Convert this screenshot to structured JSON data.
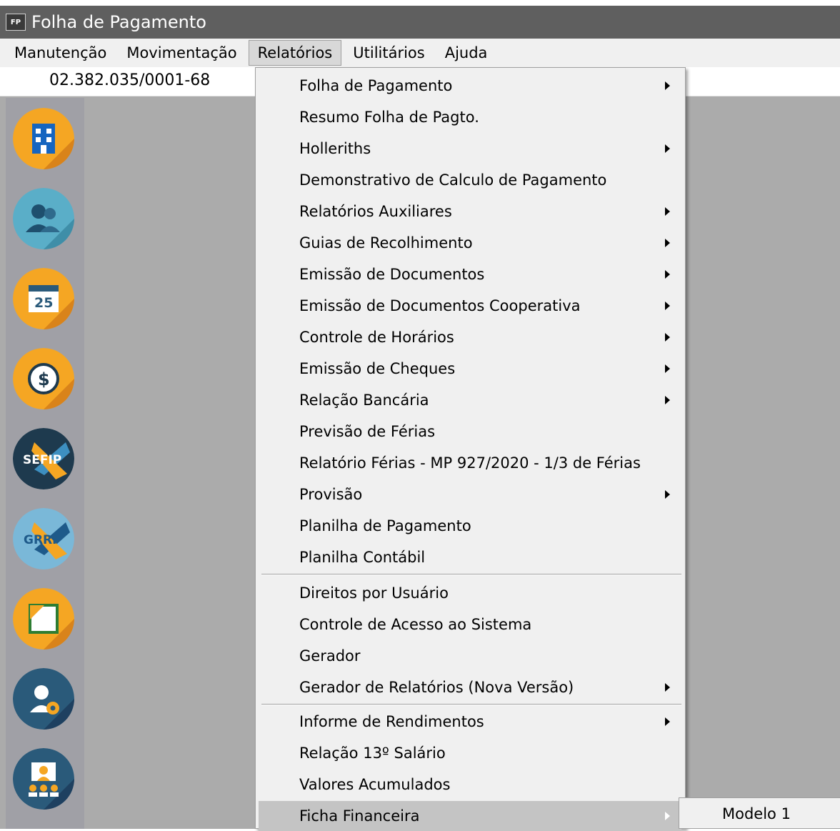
{
  "window": {
    "title": "Folha de Pagamento",
    "icon_label": "FP"
  },
  "menubar": {
    "items": [
      "Manutenção",
      "Movimentação",
      "Relatórios",
      "Utilitários",
      "Ajuda"
    ],
    "open_item": "Relatórios"
  },
  "info": {
    "cnpj": "02.382.035/0001-68"
  },
  "sidebar": {
    "buttons": [
      {
        "name": "company-icon",
        "color": "#f5a623"
      },
      {
        "name": "employees-icon",
        "color": "#5aaec8"
      },
      {
        "name": "calendar-icon",
        "color": "#f5a623",
        "text": "25"
      },
      {
        "name": "dollar-icon",
        "color": "#f5a623"
      },
      {
        "name": "sefip-icon",
        "color": "#2a5a7a",
        "text": "SEFIP"
      },
      {
        "name": "grrf-icon",
        "color": "#7ab8d8",
        "text": "GRRF"
      },
      {
        "name": "document-icon",
        "color": "#f5a623"
      },
      {
        "name": "support-settings-icon",
        "color": "#2a5a7a"
      },
      {
        "name": "users-screen-icon",
        "color": "#2a5a7a"
      }
    ]
  },
  "relatorios_menu": {
    "items": [
      {
        "label": "Folha de Pagamento",
        "submenu": true
      },
      {
        "label": "Resumo Folha de Pagto.",
        "submenu": false
      },
      {
        "label": "Holleriths",
        "submenu": true
      },
      {
        "label": "Demonstrativo de Calculo de Pagamento",
        "submenu": false
      },
      {
        "label": "Relatórios Auxiliares",
        "submenu": true
      },
      {
        "label": "Guias de Recolhimento",
        "submenu": true
      },
      {
        "label": "Emissão de Documentos",
        "submenu": true
      },
      {
        "label": "Emissão de Documentos Cooperativa",
        "submenu": true
      },
      {
        "label": "Controle de Horários",
        "submenu": true
      },
      {
        "label": "Emissão de Cheques",
        "submenu": true
      },
      {
        "label": "Relação Bancária",
        "submenu": true
      },
      {
        "label": "Previsão de Férias",
        "submenu": false
      },
      {
        "label": "Relatório Férias - MP 927/2020 - 1/3 de Férias",
        "submenu": false
      },
      {
        "label": "Provisão",
        "submenu": true
      },
      {
        "label": "Planilha de Pagamento",
        "submenu": false
      },
      {
        "label": "Planilha Contábil",
        "submenu": false
      },
      {
        "label": "Direitos por Usuário",
        "submenu": false
      },
      {
        "label": "Controle de Acesso ao Sistema",
        "submenu": false
      },
      {
        "label": "Gerador",
        "submenu": false
      },
      {
        "label": "Gerador de Relatórios (Nova Versão)",
        "submenu": true
      },
      {
        "label": "Informe de Rendimentos",
        "submenu": true
      },
      {
        "label": "Relação 13º Salário",
        "submenu": false
      },
      {
        "label": "Valores Acumulados",
        "submenu": false
      },
      {
        "label": "Ficha Financeira",
        "submenu": true,
        "selected": true
      }
    ]
  },
  "ficha_submenu": {
    "items": [
      "Modelo 1"
    ]
  }
}
